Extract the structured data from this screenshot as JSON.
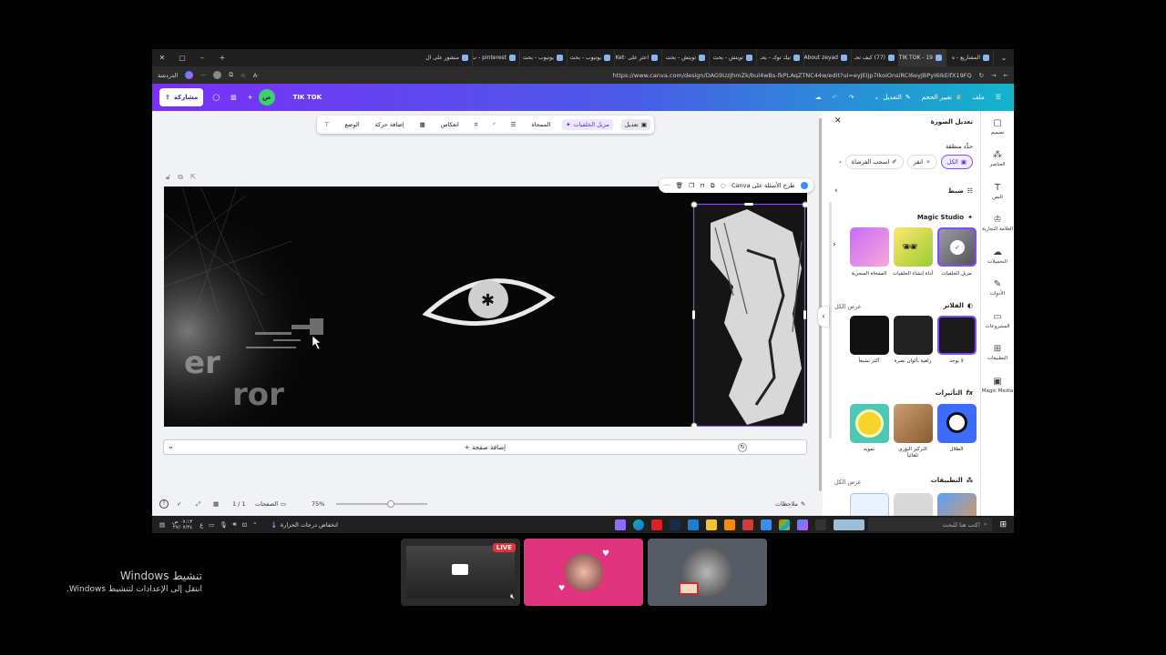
{
  "browser": {
    "tabs": [
      {
        "label": "المشاريع - ه",
        "active": false
      },
      {
        "label": "TIK TOK - 19:",
        "active": true
      },
      {
        "label": "(77) كيف تحـ",
        "active": false
      },
      {
        "label": "About zeyad",
        "active": false
      },
      {
        "label": "تيك توك - بحـ",
        "active": false
      },
      {
        "label": "تويتش - بحث",
        "active": false
      },
      {
        "label": "تويتش - بحث",
        "active": false
      },
      {
        "label": "اعثر على ·Ket",
        "active": false
      },
      {
        "label": "يوتيوب - بحث",
        "active": false
      },
      {
        "label": "يوتيوب - بحث",
        "active": false
      },
      {
        "label": "pinterest - ت",
        "active": false
      },
      {
        "label": "منشور على ال",
        "active": false
      }
    ],
    "new_tab_label": "+",
    "url": "https://www.canva.com/design/DAG9UzJhmZk/bul4wBs-fkPLAqZTNC44w/edit?ui=eyJEIjp7IkoiOnsiRCI6eyJBPyI6IkEifX19FQ",
    "profile_label": "الدردشة"
  },
  "header": {
    "menu_file": "ملف",
    "menu_resize": "تغيير الحجم",
    "menu_edit": "التعديل",
    "design_title": "TIK TOK",
    "avatar_initial": "ص",
    "share_label": "مشاركة",
    "add_label": "+"
  },
  "toolbar": {
    "edit_label": "تعديل",
    "bg_remover_label": "مزيل الخلفيات",
    "eraser_label": "الممحاة",
    "flip_label": "انعكاس",
    "add_motion_label": "إضافة حركة",
    "position_label": "الوضع"
  },
  "floating_bar": {
    "ask_label": "طرح الأسئلة على Canva"
  },
  "canvas": {
    "text_er": "er",
    "text_ror": "ror"
  },
  "add_page_label": "+ إضافة صفحة",
  "bottom_bar": {
    "notes_label": "ملاحظات",
    "zoom_label": "75%",
    "zoom_value": 0.6,
    "pages_label": "الصفحات",
    "page_counter": "1 / 1"
  },
  "side_panel": {
    "title": "تعديل الصورة",
    "select_area_label": "حدِّد منطقة",
    "select_all": "الكل",
    "select_click": "انقر",
    "select_brush": "اسحب الفرشاة",
    "adjust_label": "ضبط",
    "magic_studio_label": "Magic Studio",
    "magic_items": [
      {
        "label": "مزيل الخلفيات"
      },
      {
        "label": "أداة إنشاء الخلفيات"
      },
      {
        "label": "الممحاة السحرية"
      }
    ],
    "filters_label": "الفلاتر",
    "filters_see_all": "عرض الكل",
    "filter_items": [
      {
        "label": "لا يوجد"
      },
      {
        "label": "زاهية بألوان نضرة"
      },
      {
        "label": "أكثر تشبعاً"
      }
    ],
    "effects_label": "التأثيرات",
    "effect_items": [
      {
        "label": "الظلال"
      },
      {
        "label": "التركيز البؤري تلقائياً"
      },
      {
        "label": "تمويه"
      }
    ],
    "apps_label": "التطبيقات",
    "apps_see_all": "عرض الكل"
  },
  "side_nav": [
    {
      "label": "تصميم",
      "icon": "design-icon"
    },
    {
      "label": "العناصر",
      "icon": "elements-icon"
    },
    {
      "label": "النص",
      "icon": "text-icon"
    },
    {
      "label": "العلامة التجارية",
      "icon": "brand-icon"
    },
    {
      "label": "التحميلات",
      "icon": "uploads-icon"
    },
    {
      "label": "الأدوات",
      "icon": "tools-icon"
    },
    {
      "label": "المشروعات",
      "icon": "projects-icon"
    },
    {
      "label": "التطبيقات",
      "icon": "apps-icon"
    },
    {
      "label": "Magic Media",
      "icon": "magic-media-icon"
    }
  ],
  "taskbar": {
    "search_placeholder": "اكتب هنا للبحث",
    "weather_label": "انخفاض درجات الحرارة",
    "time": "٠٧:١٣ ص",
    "date": "٢٧/٠٧/٢٤"
  },
  "call_tiles": {
    "live_badge": "LIVE"
  },
  "watermark": {
    "title": "تنشيط Windows",
    "subtitle": "انتقل إلى الإعدادات لتنشيط Windows."
  }
}
